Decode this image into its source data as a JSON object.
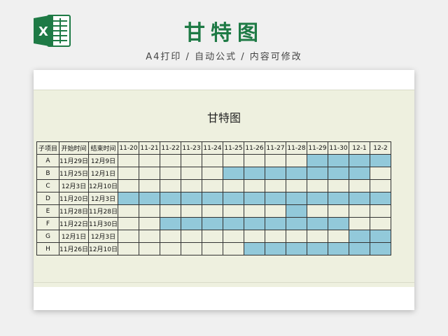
{
  "header": {
    "title": "甘特图",
    "subtitle": "A4打印 / 自动公式 / 内容可修改"
  },
  "chart": {
    "title": "甘特图"
  },
  "table": {
    "columns": [
      "子项目",
      "开始时间",
      "结束时间",
      "11-20",
      "11-21",
      "11-22",
      "11-23",
      "11-24",
      "11-25",
      "11-26",
      "11-27",
      "11-28",
      "11-29",
      "11-30",
      "12-1",
      "12-2"
    ],
    "rows": [
      {
        "id": "A",
        "start": "11月29日",
        "end": "12月9日",
        "active": [
          0,
          0,
          0,
          0,
          0,
          0,
          0,
          0,
          0,
          1,
          1,
          1,
          1
        ]
      },
      {
        "id": "B",
        "start": "11月25日",
        "end": "12月1日",
        "active": [
          0,
          0,
          0,
          0,
          0,
          1,
          1,
          1,
          1,
          1,
          1,
          1,
          0
        ]
      },
      {
        "id": "C",
        "start": "12月3日",
        "end": "12月10日",
        "active": [
          0,
          0,
          0,
          0,
          0,
          0,
          0,
          0,
          0,
          0,
          0,
          0,
          0
        ]
      },
      {
        "id": "D",
        "start": "11月20日",
        "end": "12月3日",
        "active": [
          1,
          1,
          1,
          1,
          1,
          1,
          1,
          1,
          1,
          1,
          1,
          1,
          1
        ]
      },
      {
        "id": "E",
        "start": "11月28日",
        "end": "11月28日",
        "active": [
          0,
          0,
          0,
          0,
          0,
          0,
          0,
          0,
          1,
          0,
          0,
          0,
          0
        ]
      },
      {
        "id": "F",
        "start": "11月22日",
        "end": "11月30日",
        "active": [
          0,
          0,
          1,
          1,
          1,
          1,
          1,
          1,
          1,
          1,
          1,
          0,
          0
        ]
      },
      {
        "id": "G",
        "start": "12月1日",
        "end": "12月3日",
        "active": [
          0,
          0,
          0,
          0,
          0,
          0,
          0,
          0,
          0,
          0,
          0,
          1,
          1
        ]
      },
      {
        "id": "H",
        "start": "11月26日",
        "end": "12月10日",
        "active": [
          0,
          0,
          0,
          0,
          0,
          0,
          1,
          1,
          1,
          1,
          1,
          1,
          1
        ]
      }
    ]
  },
  "colors": {
    "brand_green": "#1e7a45",
    "bar_fill": "#92c9da",
    "sheet_bg": "#eef0df"
  },
  "icons": {
    "logo": "excel-logo-icon"
  }
}
